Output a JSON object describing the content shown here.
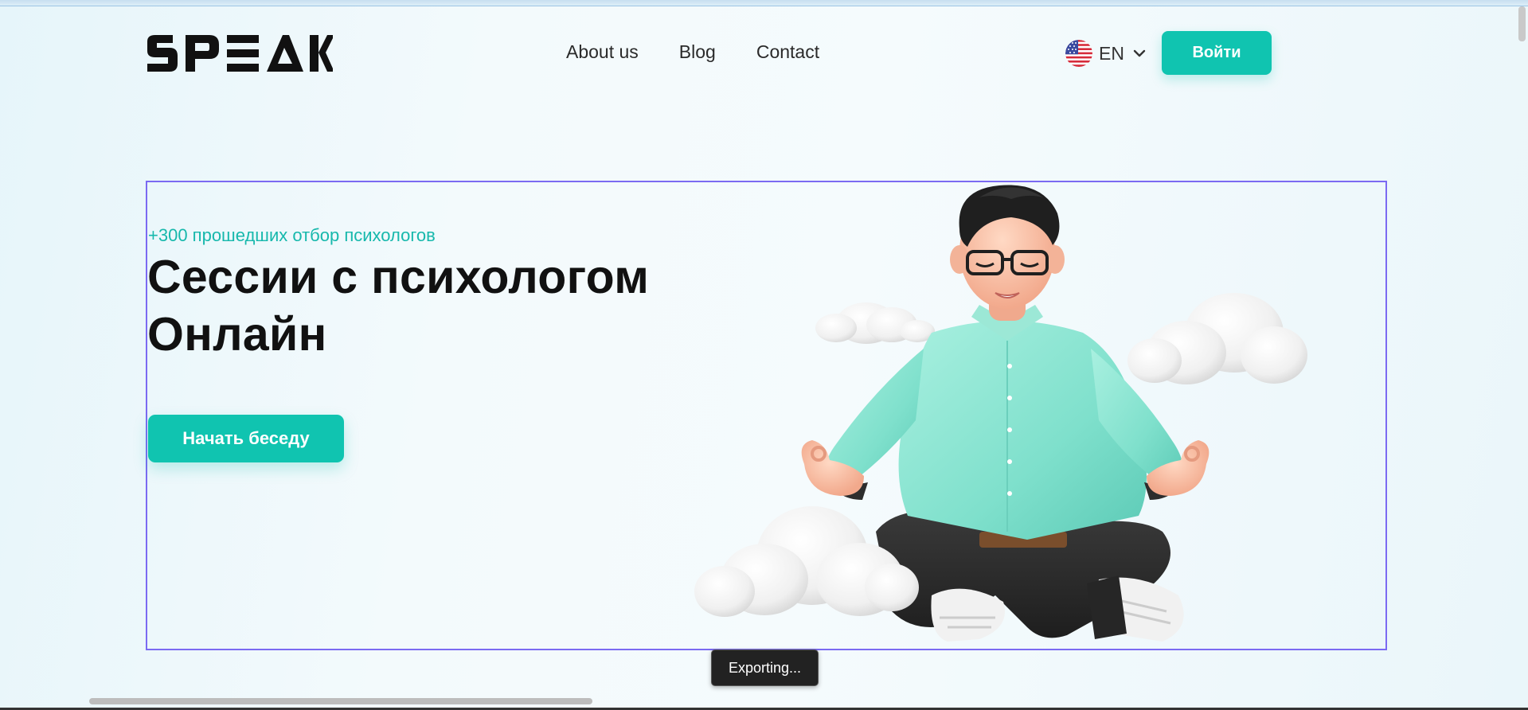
{
  "header": {
    "logo_text": "SPEAK",
    "nav": [
      "About us",
      "Blog",
      "Contact"
    ],
    "language": "EN",
    "login_label": "Войти"
  },
  "hero": {
    "subtitle": "+300 прошедших отбор психологов",
    "title_line1": "Сессии с психологом",
    "title_line2": "Онлайн",
    "cta_label": "Начать беседу"
  },
  "status": {
    "toast": "Exporting..."
  },
  "colors": {
    "accent": "#10c4b0",
    "selection_outline": "#7b6af2",
    "text_dark": "#111111"
  },
  "icons": {
    "flag": "us-flag-icon",
    "chevron": "chevron-down-icon"
  }
}
